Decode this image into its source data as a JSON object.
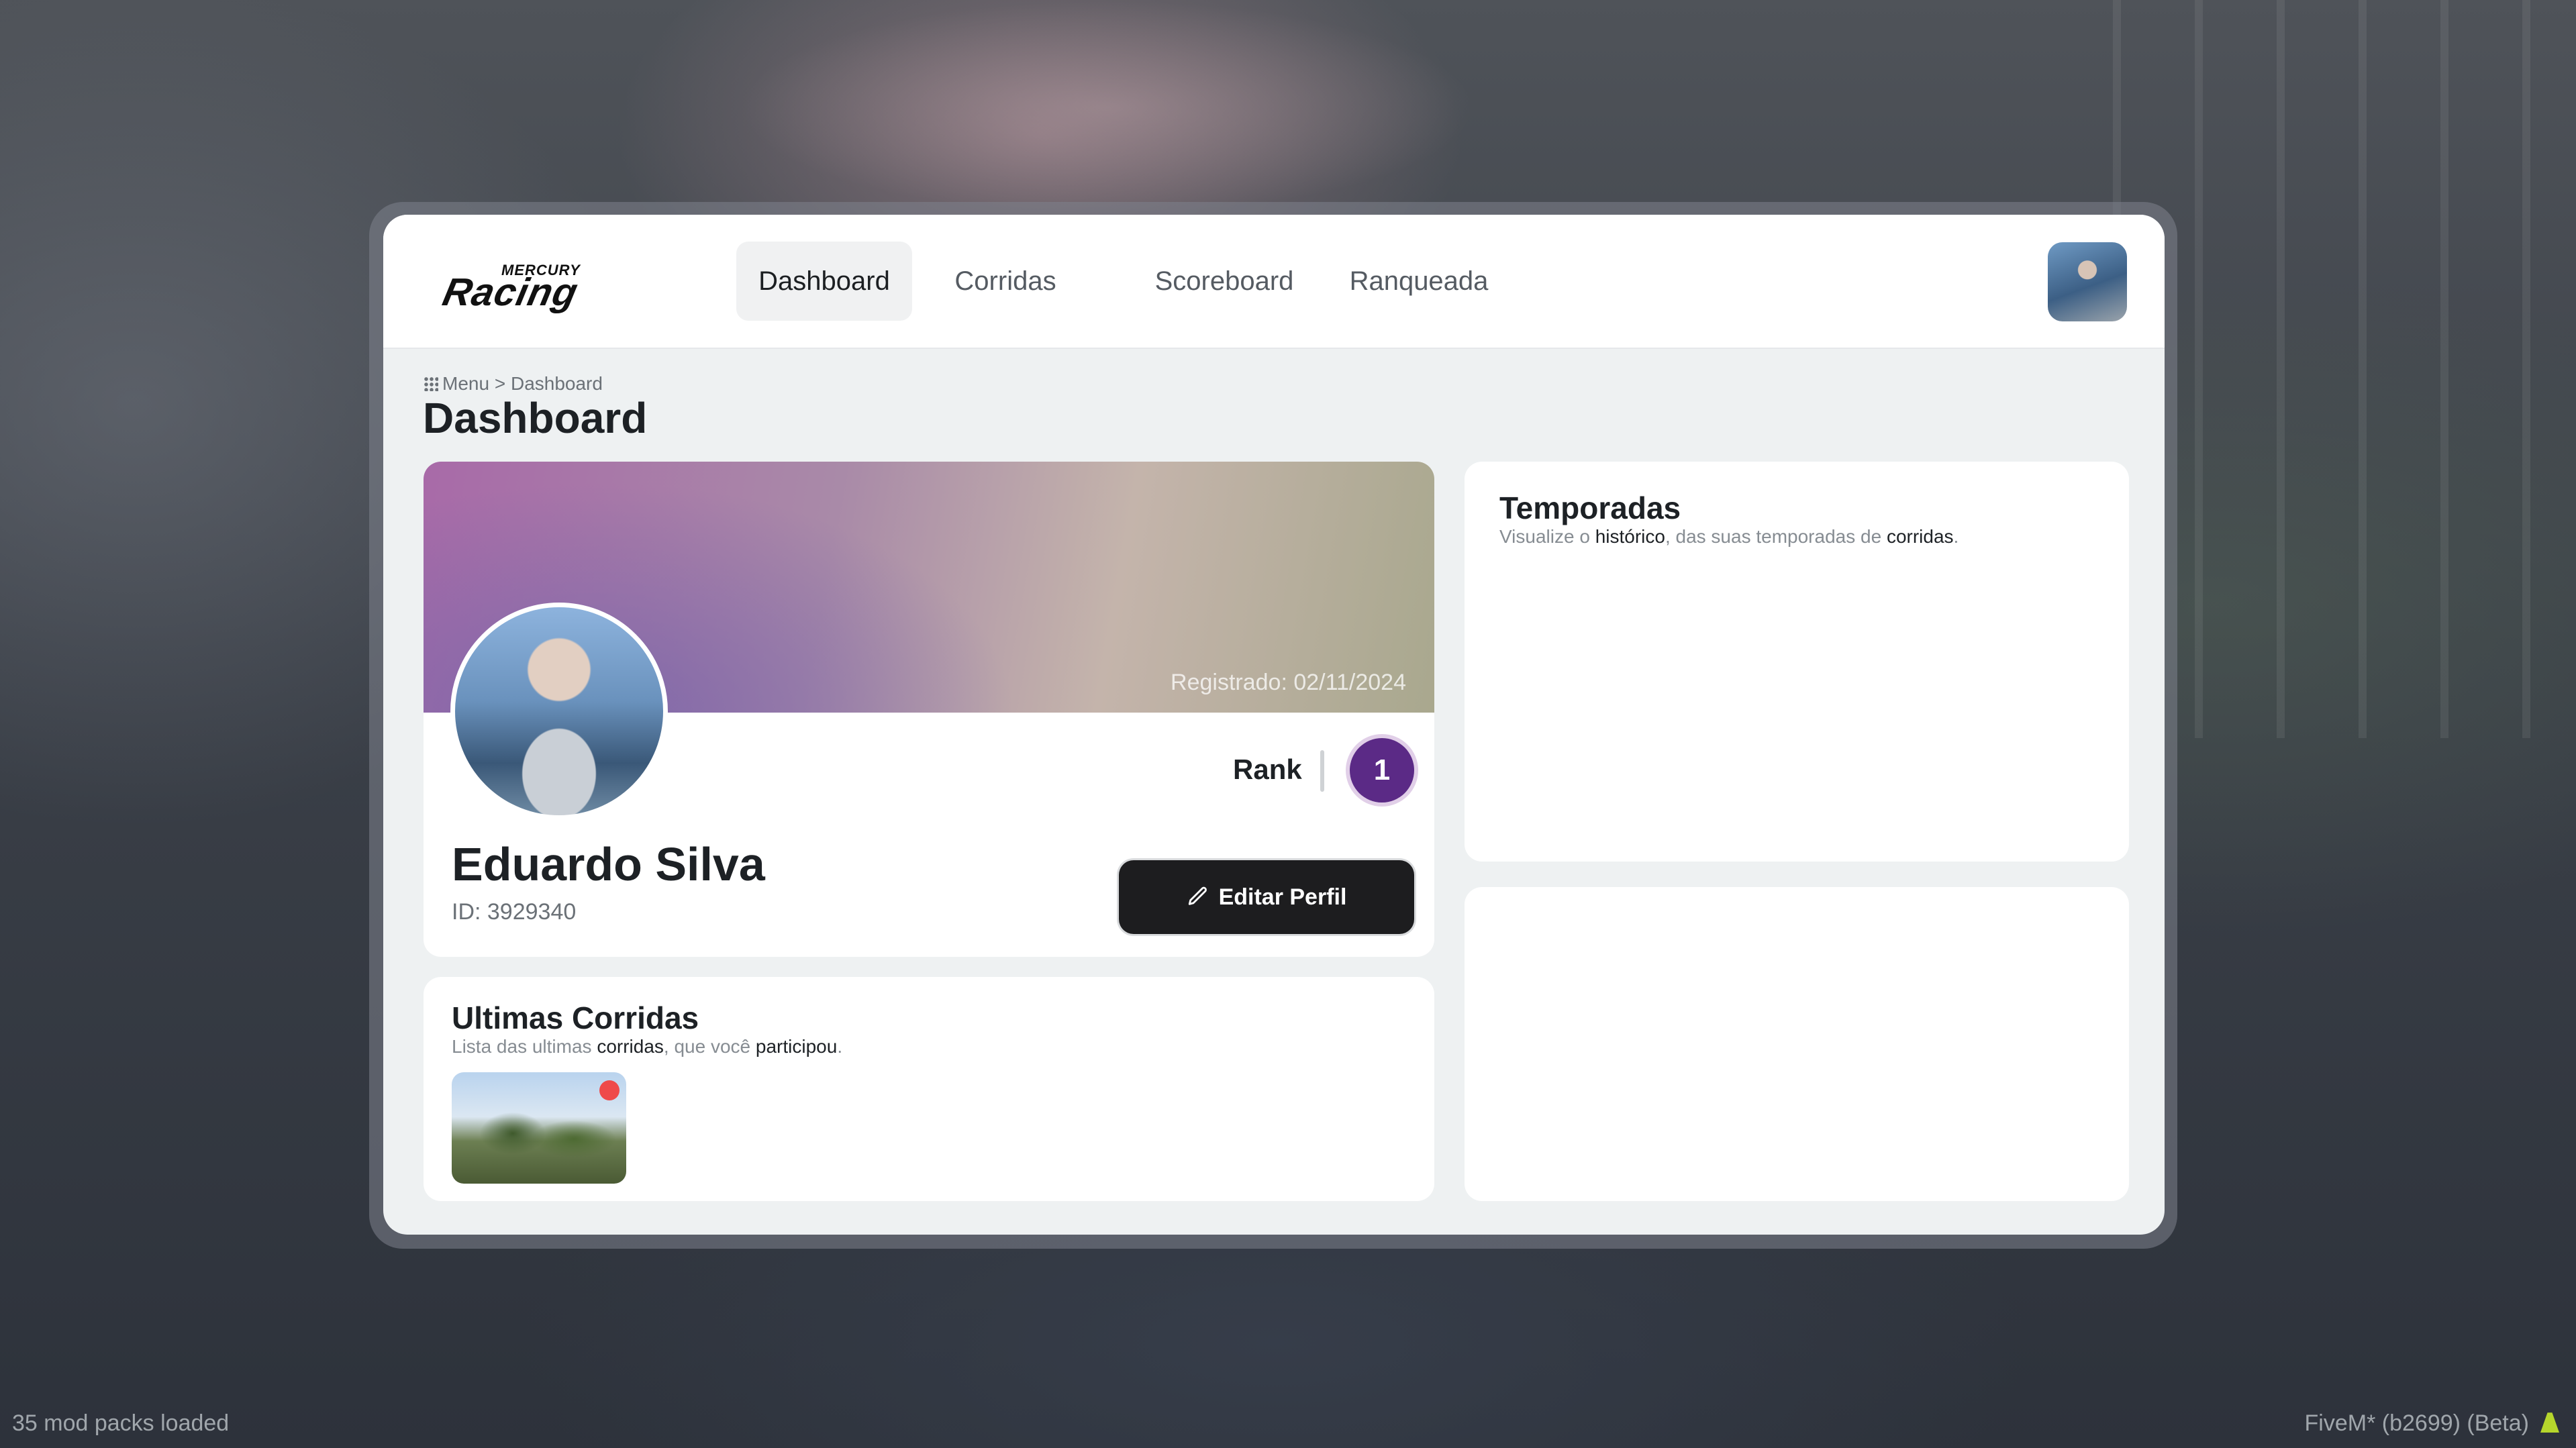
{
  "brand": {
    "small": "MERCURY",
    "big": "Racing"
  },
  "nav": {
    "tabs": [
      {
        "label": "Dashboard",
        "active": true
      },
      {
        "label": "Corridas",
        "active": false
      },
      {
        "label": "Scoreboard",
        "active": false
      },
      {
        "label": "Ranqueada",
        "active": false
      }
    ]
  },
  "breadcrumb": {
    "menu": "Menu",
    "separator": ">",
    "current": "Dashboard"
  },
  "page_title": "Dashboard",
  "profile": {
    "registered": "Registrado: 02/11/2024",
    "rank_label": "Rank",
    "rank_value": "1",
    "name": "Eduardo Silva",
    "id": "ID: 3929340",
    "edit_button": "Editar Perfil"
  },
  "races": {
    "title": "Ultimas Corridas",
    "subtitle": {
      "p1": "Lista das ultimas ",
      "b1": "corridas",
      "p2": ", que você ",
      "b2": "participou",
      "p3": "."
    }
  },
  "seasons": {
    "title": "Temporadas",
    "subtitle": {
      "p1": "Visualize o ",
      "b1": "histórico",
      "p2": ", das suas temporadas de ",
      "b2": "corridas",
      "p3": "."
    }
  },
  "status": {
    "left": "35 mod packs loaded",
    "right": "FiveM* (b2699) (Beta)"
  },
  "colors": {
    "rank_badge": "#5b2a86",
    "edit_button": "#1d1d1f",
    "race_status_dot": "#ef4a4a",
    "fivem_icon": "#b6d62c"
  },
  "icons": {
    "breadcrumb": "grid-dots-icon",
    "edit": "pencil-icon",
    "fivem": "fivem-logo-icon"
  }
}
